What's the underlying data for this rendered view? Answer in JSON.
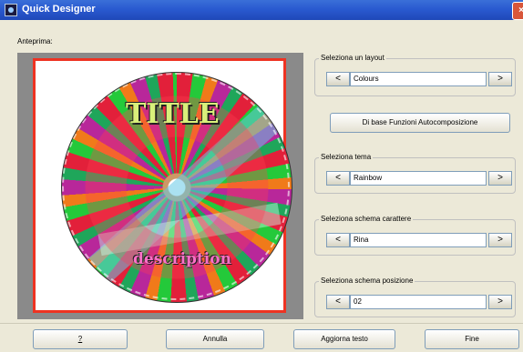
{
  "window": {
    "title": "Quick Designer",
    "close_icon": "×"
  },
  "preview": {
    "label": "Anteprima:",
    "disc_title": "TITLE",
    "disc_description": "description"
  },
  "layout_group": {
    "title": "Seleziona un layout",
    "value": "Colours",
    "prev": "<",
    "next": ">"
  },
  "auto_button": {
    "label": "Di base Funzioni Autocomposizione"
  },
  "theme_group": {
    "title": "Seleziona tema",
    "value": "Rainbow",
    "prev": "<",
    "next": ">"
  },
  "font_group": {
    "title": "Seleziona schema carattere",
    "value": "Rina",
    "prev": "<",
    "next": ">"
  },
  "position_group": {
    "title": "Seleziona schema posizione",
    "value": "02",
    "prev": "<",
    "next": ">"
  },
  "footer": {
    "help": "?",
    "cancel": "Annulla",
    "update_text": "Aggiorna testo",
    "finish": "Fine"
  }
}
